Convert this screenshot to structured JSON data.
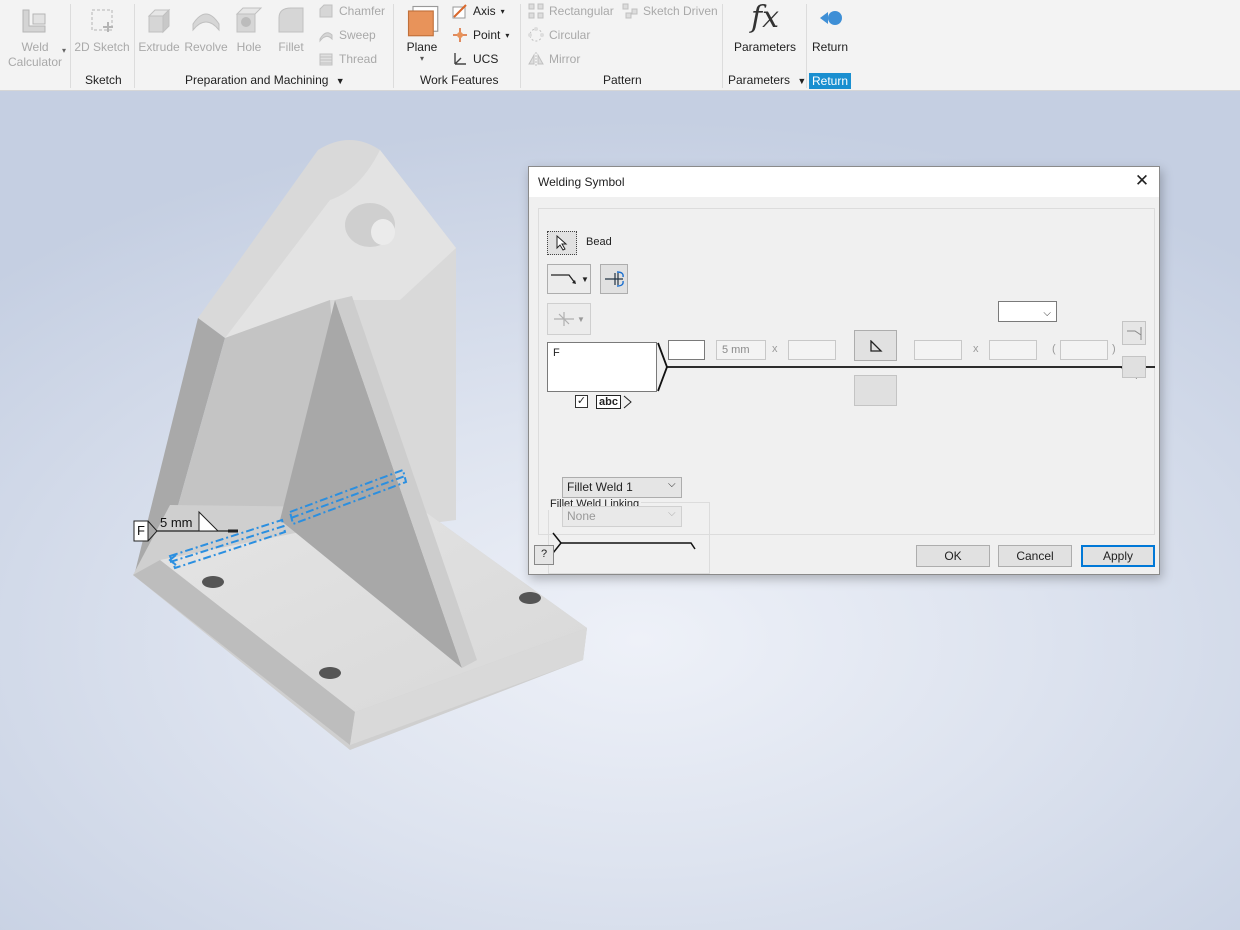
{
  "ribbon": {
    "sketch_group": {
      "weld_calculator": "Weld\nCalculator",
      "weld_calc_line1": "Weld",
      "weld_calc_line2": "Calculator",
      "sketch_2d": "2D Sketch",
      "label": "Sketch"
    },
    "prep_group": {
      "extrude": "Extrude",
      "revolve": "Revolve",
      "hole": "Hole",
      "fillet": "Fillet",
      "chamfer": "Chamfer",
      "sweep": "Sweep",
      "thread": "Thread",
      "label": "Preparation and Machining"
    },
    "work_group": {
      "plane": "Plane",
      "axis": "Axis",
      "point": "Point",
      "ucs": "UCS",
      "label": "Work Features"
    },
    "pattern_group": {
      "rectangular": "Rectangular",
      "sketch_driven": "Sketch Driven",
      "circular": "Circular",
      "mirror": "Mirror",
      "label": "Pattern"
    },
    "parameters_group": {
      "parameters": "Parameters",
      "fx": "fx",
      "label": "Parameters"
    },
    "return_group": {
      "return": "Return",
      "label": "Return"
    }
  },
  "model": {
    "annotation_letter": "F",
    "annotation_size": "5 mm"
  },
  "dialog": {
    "title": "Welding Symbol",
    "bead_label": "Bead",
    "note_text": "F",
    "size_value": "5 mm",
    "x_symbol": "x",
    "paren_open": "(",
    "paren_close": ")",
    "abc_label": "abc",
    "abc_checked": true,
    "fillet_weld_linking": {
      "title": "Fillet Weld Linking",
      "first_value": "Fillet Weld 1",
      "second_value": "None"
    },
    "buttons": {
      "ok": "OK",
      "cancel": "Cancel",
      "apply": "Apply",
      "help": "?"
    }
  },
  "colors": {
    "accent_blue": "#1a8fd0",
    "weld_highlight": "#2b8fe0",
    "plane_orange": "#e8935a"
  }
}
